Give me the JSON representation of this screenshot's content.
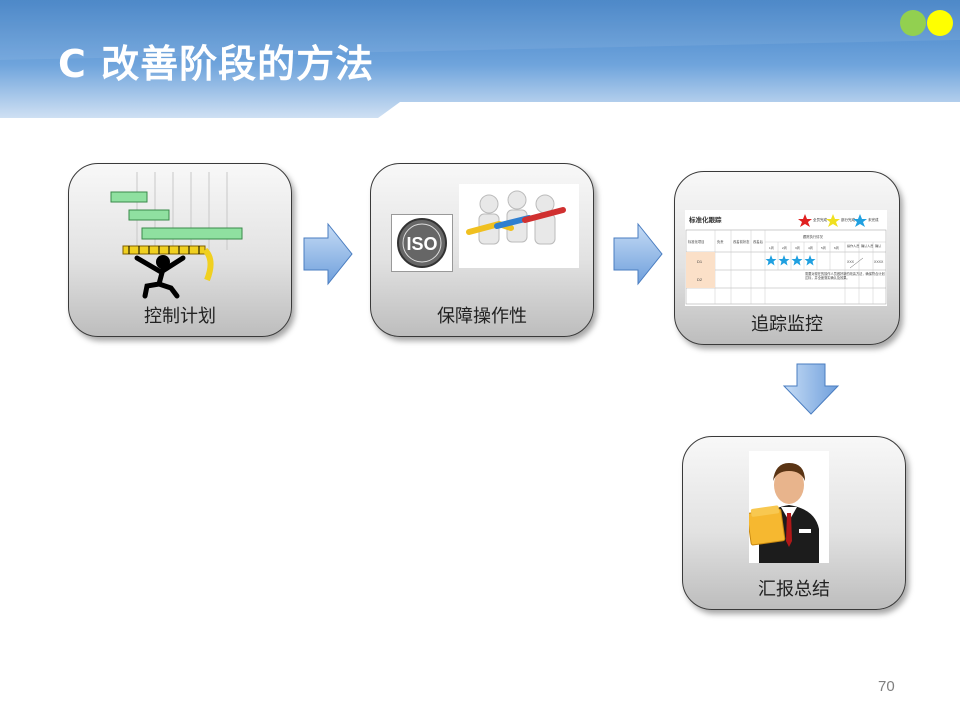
{
  "slide": {
    "title": "C 改善阶段的方法",
    "page_number": "70"
  },
  "colors": {
    "header_top": "#5b9bd5",
    "header_bottom": "#dbe8f6",
    "dot_green": "#92d050",
    "dot_yellow": "#ffff00",
    "arrow_fill": "#8db3e2"
  },
  "steps": [
    {
      "label": "控制计划",
      "icon": "gantt-progress-icon"
    },
    {
      "label": "保障操作性",
      "icon": "iso-teamwork-icon"
    },
    {
      "label": "追踪监控",
      "icon": "tracking-table-icon"
    },
    {
      "label": "汇报总结",
      "icon": "businessman-folder-icon"
    }
  ],
  "iso_mark": "ISO",
  "tracking_table": {
    "title": "标准化跟踪",
    "legend": [
      "全员完成",
      "部分完成",
      "未完成"
    ],
    "headers": [
      "标准化项目",
      "负责",
      "改善前状态",
      "改善后",
      "跟踪执行情况"
    ],
    "sub_headers": [
      "1周",
      "2周",
      "3周",
      "4周",
      "5周",
      "6周",
      "操作人员",
      "确认人员",
      "确认"
    ],
    "rows": [
      "D1",
      "D2"
    ],
    "row_marks": [
      "XXX",
      "XXXX"
    ],
    "note": "需要对现在的操作人员做好新的改善方法，确保符合计划达标，并全面落实确认及效果。"
  }
}
